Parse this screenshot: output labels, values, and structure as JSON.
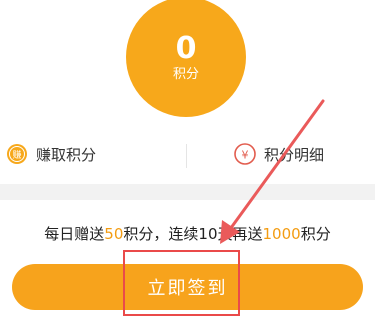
{
  "points": {
    "value": "0",
    "unit": "积分"
  },
  "actions": {
    "earn": {
      "label": "赚取积分",
      "icon": "coin-icon",
      "icon_glyph": "赚"
    },
    "detail": {
      "label": "积分明细",
      "icon": "yen-coin-icon",
      "icon_glyph": "¥"
    }
  },
  "notice": {
    "prefix": "每日赠送",
    "daily_points": "50",
    "mid": "积分，连续",
    "days": "10",
    "mid2": "天再送",
    "bonus_points": "1000",
    "suffix": "积分"
  },
  "checkin_button": {
    "label": "立即签到"
  },
  "colors": {
    "accent": "#f7a81b",
    "highlight_text": "#f39c12",
    "annotation": "#ea4a4a"
  }
}
